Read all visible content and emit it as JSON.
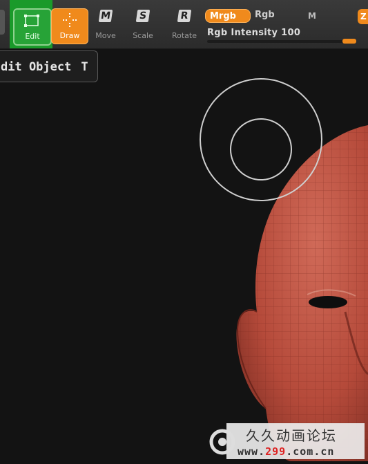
{
  "toolbar": {
    "edit_label": "Edit",
    "draw_label": "Draw",
    "move_label": "Move",
    "move_key": "M",
    "scale_label": "Scale",
    "scale_key": "S",
    "rotate_label": "Rotate",
    "rotate_key": "R",
    "mrgb_label": "Mrgb",
    "rgb_label": "Rgb",
    "m_label": "M",
    "intensity_label": "Rgb Intensity",
    "intensity_value": "100",
    "intensity_fraction": 1.0,
    "z_label": "Z"
  },
  "tooltip": {
    "text": "dit Object",
    "hotkey": "T"
  },
  "watermark": {
    "title": "久久动画论坛",
    "url_prefix": "www.",
    "url_accent": "299",
    "url_suffix": ".com.cn"
  },
  "colors": {
    "accent": "#f08a1c",
    "edit_active": "#27a337",
    "mesh": "#b54a3a"
  }
}
